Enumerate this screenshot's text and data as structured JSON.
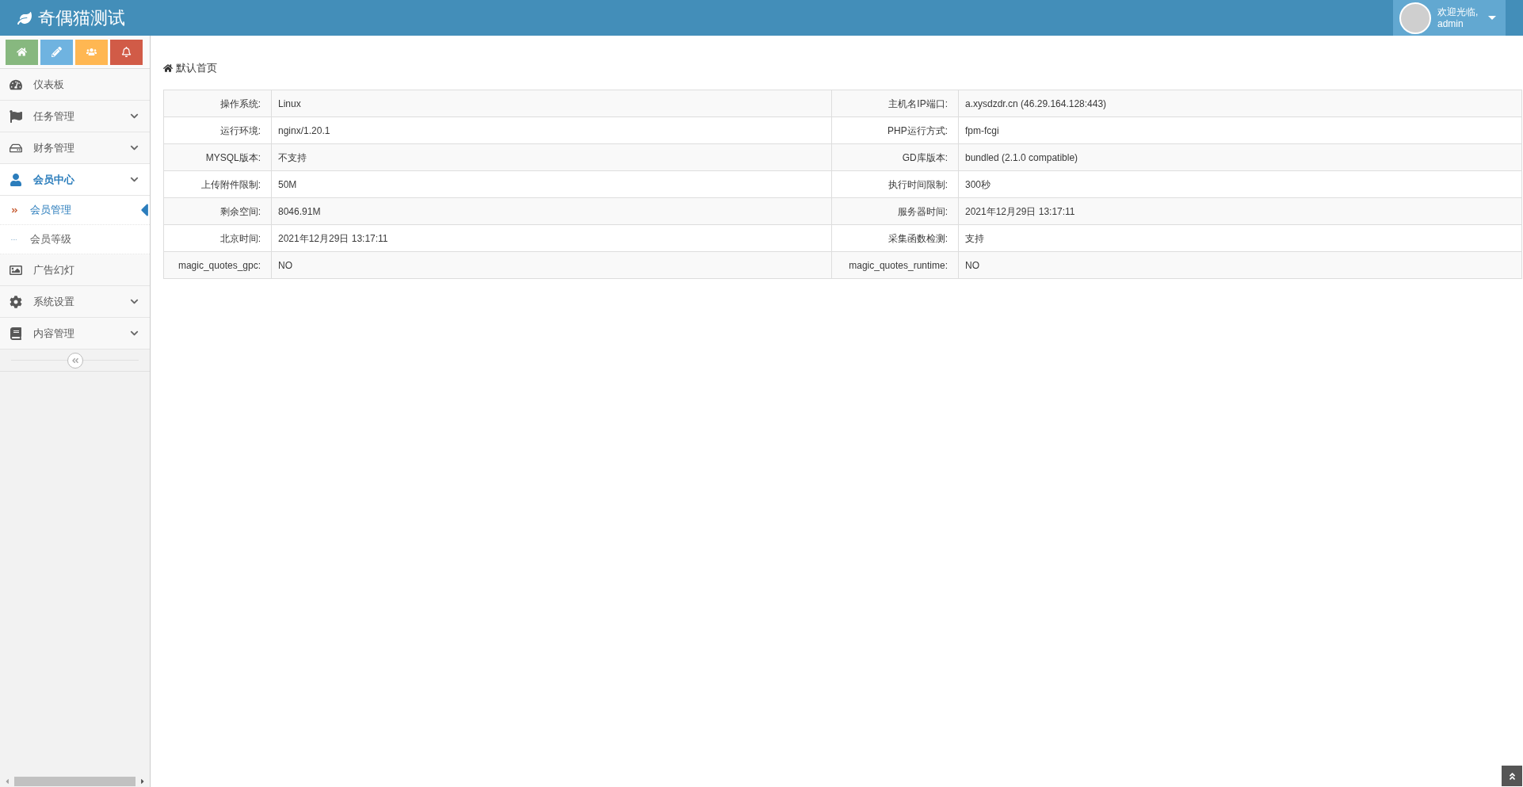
{
  "header": {
    "title": "奇偶猫测试",
    "greeting": "欢迎光临,",
    "username": "admin"
  },
  "shortcuts": [
    {
      "kind": "home",
      "color": "#87b87f"
    },
    {
      "kind": "pencil",
      "color": "#6fb3e0"
    },
    {
      "kind": "users",
      "color": "#ffb752"
    },
    {
      "kind": "bell",
      "color": "#d15b47"
    }
  ],
  "menu": [
    {
      "label": "仪表板",
      "kind": "dashboard",
      "submenu": false,
      "selected": false
    },
    {
      "label": "任务管理",
      "kind": "flag",
      "submenu": true,
      "selected": false
    },
    {
      "label": "财务管理",
      "kind": "drive",
      "submenu": true,
      "selected": false
    },
    {
      "label": "会员中心",
      "kind": "user",
      "submenu": true,
      "selected": true,
      "children": [
        {
          "label": "会员管理",
          "selected": true
        },
        {
          "label": "会员等级",
          "selected": false
        }
      ]
    },
    {
      "label": "广告幻灯",
      "kind": "image",
      "submenu": false,
      "selected": false
    },
    {
      "label": "系统设置",
      "kind": "gear",
      "submenu": true,
      "selected": false
    },
    {
      "label": "内容管理",
      "kind": "book",
      "submenu": true,
      "selected": false
    }
  ],
  "breadcrumb": "默认首页",
  "table": {
    "rows": [
      {
        "label_1": "操作系统:",
        "value_1": "Linux",
        "label_2": "主机名IP端口:",
        "value_2": "a.xysdzdr.cn (46.29.164.128:443)"
      },
      {
        "label_1": "运行环境:",
        "value_1": "nginx/1.20.1",
        "label_2": "PHP运行方式:",
        "value_2": "fpm-fcgi"
      },
      {
        "label_1": "MYSQL版本:",
        "value_1": "不支持",
        "label_2": "GD库版本:",
        "value_2": "bundled (2.1.0 compatible)"
      },
      {
        "label_1": "上传附件限制:",
        "value_1": "50M",
        "label_2": "执行时间限制:",
        "value_2": "300秒"
      },
      {
        "label_1": "剩余空间:",
        "value_1": "8046.91M",
        "label_2": "服务器时间:",
        "value_2": "2021年12月29日 13:17:11"
      },
      {
        "label_1": "北京时间:",
        "value_1": "2021年12月29日 13:17:11",
        "label_2": "采集函数检测:",
        "value_2": "支持"
      },
      {
        "label_1": "magic_quotes_gpc:",
        "value_1": "NO",
        "label_2": "magic_quotes_runtime:",
        "value_2": "NO"
      }
    ]
  }
}
